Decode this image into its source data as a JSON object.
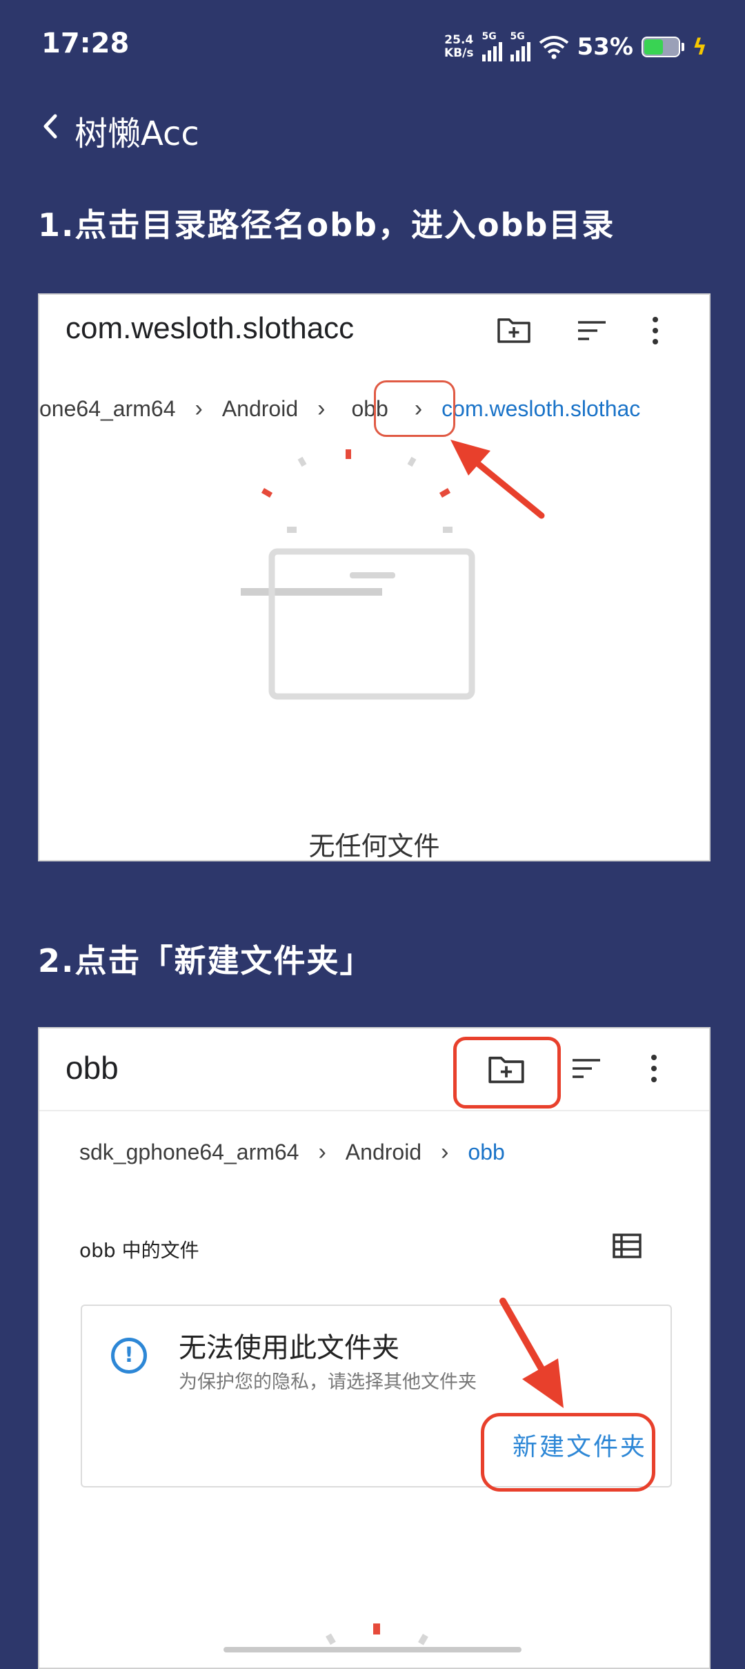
{
  "status": {
    "time": "17:28",
    "net_speed_value": "25.4",
    "net_speed_unit": "KB/s",
    "sim1": "5G",
    "sim2": "5G",
    "battery_percent": "53%"
  },
  "appbar": {
    "title": "树懒Acc",
    "back_icon": "chevron-left-icon"
  },
  "steps": [
    {
      "title": "1.点击目录路径名obb，进入obb目录",
      "screenshot": {
        "title": "com.wesloth.slothacc",
        "crumbs": [
          "one64_arm64",
          "Android",
          "obb",
          "com.wesloth.slothac"
        ],
        "empty_text": "无任何文件"
      }
    },
    {
      "title": "2.点击「新建文件夹」",
      "screenshot": {
        "title": "obb",
        "crumbs": [
          "sdk_gphone64_arm64",
          "Android",
          "obb"
        ],
        "files_label": "obb 中的文件",
        "card": {
          "icon": "info-icon",
          "title": "无法使用此文件夹",
          "subtitle": "为保护您的隐私，请选择其他文件夹",
          "action": "新建文件夹"
        }
      }
    }
  ],
  "colors": {
    "background": "#2d376b",
    "accent": "#1a73c8",
    "highlight": "#e05a44",
    "arrow": "#e8402c"
  }
}
